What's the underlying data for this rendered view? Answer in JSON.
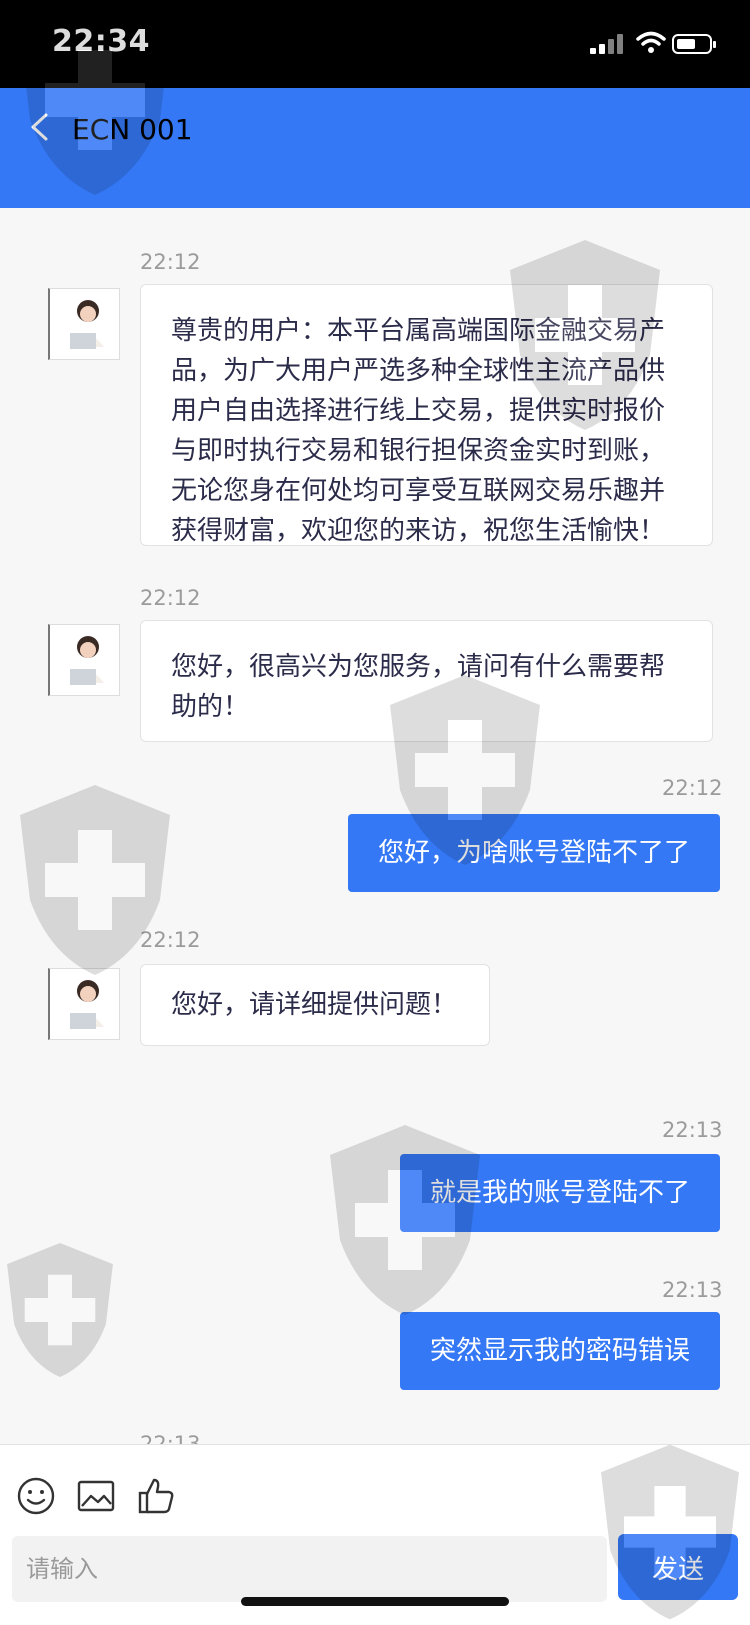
{
  "status_bar": {
    "time": "22:34"
  },
  "header": {
    "back_icon": "chevron-left-icon",
    "title": "ECN 001"
  },
  "messages": [
    {
      "side": "in",
      "time": "22:12",
      "text": "尊贵的用户：本平台属高端国际金融交易产品，为广大用户严选多种全球性主流产品供用户自由选择进行线上交易，提供实时报价与即时执行交易和银行担保资金实时到账，无论您身在何处均可享受互联网交易乐趣并获得财富，欢迎您的来访，祝您生活愉快！"
    },
    {
      "side": "in",
      "time": "22:12",
      "text": "您好，很高兴为您服务，请问有什么需要帮助的！"
    },
    {
      "side": "out",
      "time": "22:12",
      "text": "您好，为啥账号登陆不了了"
    },
    {
      "side": "in",
      "time": "22:12",
      "text": "您好，请详细提供问题！"
    },
    {
      "side": "out",
      "time": "22:13",
      "text": "就是我的账号登陆不了"
    },
    {
      "side": "out",
      "time": "22:13",
      "text": "突然显示我的密码错误"
    }
  ],
  "input_bar": {
    "icons": [
      "emoji-icon",
      "image-icon",
      "thumbs-up-icon"
    ],
    "placeholder": "请输入",
    "send_label": "发送"
  },
  "colors": {
    "accent": "#3478f6",
    "status_bar": "#000000",
    "chat_bg": "#f7f7f7"
  }
}
